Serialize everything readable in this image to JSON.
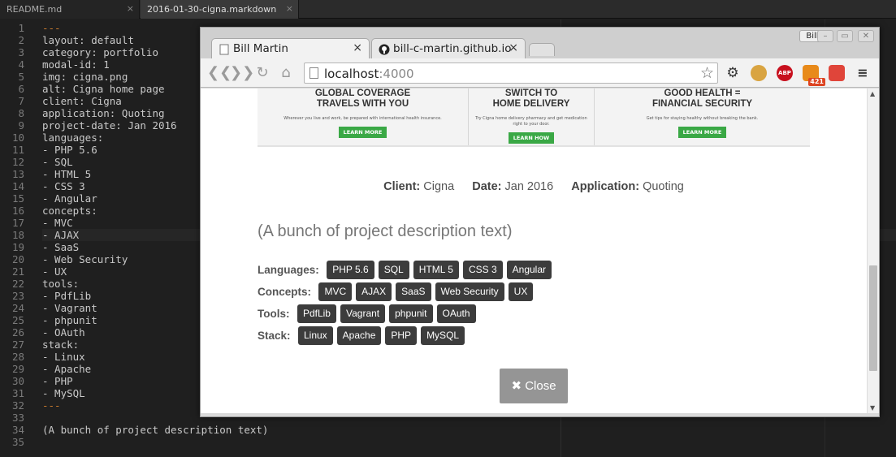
{
  "editor": {
    "tabs": [
      {
        "label": "README.md",
        "close": "×"
      },
      {
        "label": "2016-01-30-cigna.markdown",
        "close": "×"
      }
    ],
    "line_numbers": [
      "1",
      "2",
      "3",
      "4",
      "5",
      "6",
      "7",
      "8",
      "9",
      "10",
      "11",
      "12",
      "13",
      "14",
      "15",
      "16",
      "17",
      "18",
      "19",
      "20",
      "21",
      "22",
      "23",
      "24",
      "25",
      "26",
      "27",
      "28",
      "29",
      "30",
      "31",
      "32",
      "33",
      "34",
      "35"
    ],
    "lines": [
      "---",
      "layout: default",
      "category: portfolio",
      "modal-id: 1",
      "img: cigna.png",
      "alt: Cigna home page",
      "client: Cigna",
      "application: Quoting",
      "project-date: Jan 2016",
      "languages:",
      "- PHP 5.6",
      "- SQL",
      "- HTML 5",
      "- CSS 3",
      "- Angular",
      "concepts:",
      "- MVC",
      "- AJAX",
      "- SaaS",
      "- Web Security",
      "- UX",
      "tools:",
      "- PdfLib",
      "- Vagrant",
      "- phpunit",
      "- OAuth",
      "stack:",
      "- Linux",
      "- Apache",
      "- PHP",
      "- MySQL",
      "---",
      "",
      "(A bunch of project description text)",
      ""
    ]
  },
  "browser": {
    "tabs": [
      {
        "title": "Bill Martin",
        "close": "×"
      },
      {
        "title": "bill-c-martin.github.io",
        "close": "×"
      }
    ],
    "profile": "Bill",
    "window_controls": {
      "minimize": "–",
      "maximize": "▭",
      "close": "✕"
    },
    "address": {
      "host": "localhost",
      "port": ":4000"
    },
    "extension_badge": "421",
    "ext_abp": "ABP"
  },
  "page": {
    "promo": [
      {
        "heading_1": "GLOBAL COVERAGE",
        "heading_2": "TRAVELS WITH YOU",
        "text": "Wherever you live and work, be prepared with international health insurance.",
        "button": "LEARN MORE"
      },
      {
        "heading_1": "SWITCH TO",
        "heading_2": "HOME DELIVERY",
        "text": "Try Cigna home delivery pharmacy and get medication right to your door.",
        "button": "LEARN HOW"
      },
      {
        "heading_1": "GOOD HEALTH =",
        "heading_2": "FINANCIAL SECURITY",
        "text": "Get tips for staying healthy without breaking the bank.",
        "button": "LEARN MORE"
      }
    ],
    "meta": {
      "client_label": "Client:",
      "client": "Cigna",
      "date_label": "Date:",
      "date": "Jan 2016",
      "application_label": "Application:",
      "application": "Quoting"
    },
    "description": "(A bunch of project description text)",
    "tag_groups": [
      {
        "label": "Languages:",
        "tags": [
          "PHP 5.6",
          "SQL",
          "HTML 5",
          "CSS 3",
          "Angular"
        ]
      },
      {
        "label": "Concepts:",
        "tags": [
          "MVC",
          "AJAX",
          "SaaS",
          "Web Security",
          "UX"
        ]
      },
      {
        "label": "Tools:",
        "tags": [
          "PdfLib",
          "Vagrant",
          "phpunit",
          "OAuth"
        ]
      },
      {
        "label": "Stack:",
        "tags": [
          "Linux",
          "Apache",
          "PHP",
          "MySQL"
        ]
      }
    ],
    "close_button": "Close"
  }
}
